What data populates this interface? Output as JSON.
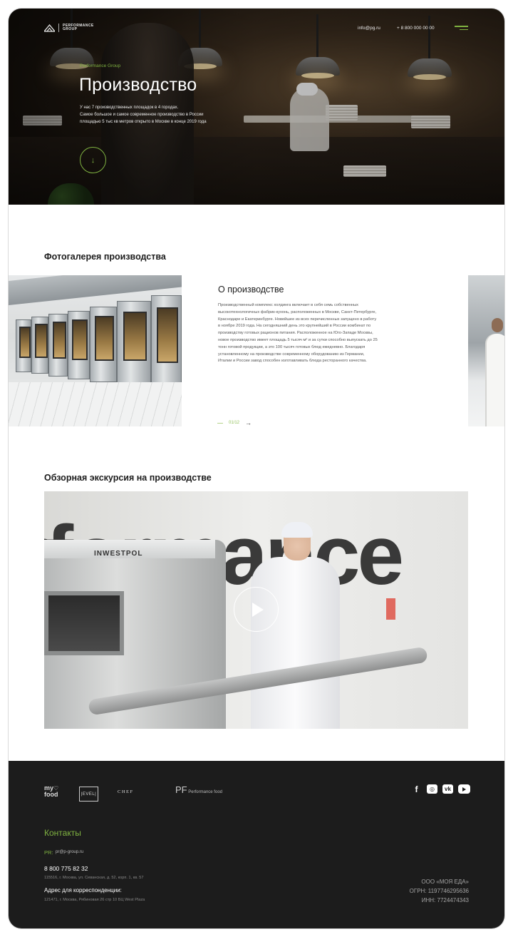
{
  "header": {
    "logo_text_line1": "PERFORMANCE",
    "logo_text_line2": "GROUP",
    "email": "info@pg.ru",
    "phone": "+ 8 800 000 00 00",
    "menu_icon": "burger-menu-icon",
    "accent_color": "#7fb241"
  },
  "hero": {
    "kicker": "Performance Group",
    "title": "Производство",
    "description": [
      "У нас 7 производственных площадок в 4 городах.",
      "Самое большое и самое современное производство в России",
      "площадью 5 тыс кв метров открыто в Москве в конце 2019 года"
    ],
    "scroll_icon": "arrow-down-icon"
  },
  "gallery": {
    "title": "Фотогалерея производства",
    "about_title": "О производстве",
    "about_text": [
      "Производственный комплекс холдинга включает в себя семь собственных",
      "высокотехнологичных фабрик-кухонь, расположенных в  Москве, Санкт-Петербурге,",
      "Краснодаре и Екатеринбурге. Новейшее из всех перечисленных запущено в работу",
      "в ноябре 2019 года. На сегодняшний день это крупнейший в России комбинат по",
      "производству готовых рационов питания. Расположенное на Юго-Западе Москвы,",
      "новое производство имеет площадь 5 тысяч м² и за сутки способно выпускать до 25",
      "тонн готовой продукции, а это 100 тысяч готовых блюд ежедневно. Благодаря",
      "установленному на производстве современному оборудованию из Германии,",
      "Италии и России завод способен изготавливать блюда ресторанного качества."
    ],
    "pager": "01/12",
    "next_icon": "arrow-right-icon"
  },
  "video": {
    "title": "Обзорная экскурсия на производстве",
    "machine_label": "INWESTPOL",
    "wall_text": "rformance",
    "play_icon": "play-icon"
  },
  "footer": {
    "brands": {
      "myfood_line1": "my",
      "myfood_line2": "food",
      "level": "|EVEL|",
      "chef": "CHEF",
      "pf_mark": "PF",
      "pf_text": "Performance food"
    },
    "socials": [
      {
        "name": "facebook-icon",
        "glyph": "f"
      },
      {
        "name": "instagram-icon",
        "glyph": "◎"
      },
      {
        "name": "vk-icon",
        "glyph": "vk"
      },
      {
        "name": "youtube-icon",
        "glyph": ""
      }
    ],
    "contacts_title": "Контакты",
    "pr_label": "PR:",
    "pr_email": "pr@p-group.ru",
    "phone": "8 800 775 82 32",
    "address1": "115516, г. Москва, ул. Севанская, д. 52, корп. 1, кв. 57",
    "corr_label": "Адрес для корреспонденции:",
    "address2": "121471, г. Москва, Рябиновая 26 стр 10 БЦ West Plaza",
    "legal": {
      "company": "ООО «МОЯ ЕДА»",
      "ogrn": "ОГРН: 1197746295636",
      "inn": "ИНН: 7724474343"
    }
  }
}
